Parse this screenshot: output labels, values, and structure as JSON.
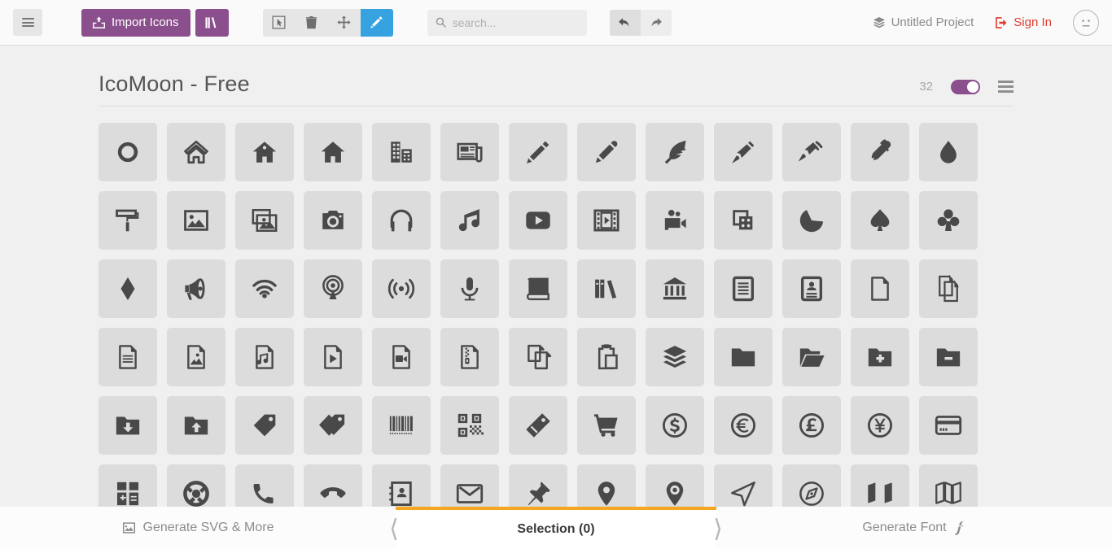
{
  "toolbar": {
    "menu_icon": "hamburger-icon",
    "import_label": "Import Icons",
    "import_icon": "upload-box-icon",
    "library_icon": "books-icon",
    "tools": [
      {
        "name": "select-tool",
        "icon": "cursor-select-icon",
        "active": false
      },
      {
        "name": "delete-tool",
        "icon": "trash-icon",
        "active": false
      },
      {
        "name": "move-tool",
        "icon": "move-arrows-icon",
        "active": false
      },
      {
        "name": "edit-tool",
        "icon": "pencil-icon",
        "active": true
      }
    ],
    "search": {
      "placeholder": "search...",
      "value": "",
      "icon": "search-icon"
    },
    "undo_icon": "undo-arrow-icon",
    "redo_icon": "redo-arrow-icon",
    "project_label": "Untitled Project",
    "project_icon": "stack-layers-icon",
    "signin_label": "Sign In",
    "signin_icon": "login-arrow-icon",
    "avatar_icon": "neutral-face-icon",
    "accent_purple": "#8a4f8c",
    "accent_blue": "#37a2e0",
    "accent_red": "#e23a2e"
  },
  "iconset": {
    "title": "IcoMoon - Free",
    "count": "32",
    "toggle_on": true,
    "toggle_color": "#8a4f8c",
    "menu_icon": "list-menu-icon",
    "icons": [
      "home3",
      "home",
      "home2",
      "home5",
      "office",
      "newspaper",
      "pencil",
      "pencil2",
      "quill",
      "pen",
      "blog",
      "eyedropper",
      "droplet",
      "paint-format",
      "image",
      "images",
      "camera",
      "headphones",
      "music",
      "play",
      "film",
      "video-camera",
      "dice",
      "pacman",
      "spades",
      "clubs",
      "diamonds",
      "bullhorn",
      "connection",
      "podcast",
      "feed",
      "mic",
      "book",
      "books",
      "library",
      "file-text",
      "profile",
      "file-empty",
      "files-empty",
      "file-text2",
      "file-picture",
      "file-music",
      "file-play",
      "file-video",
      "file-zip",
      "copy",
      "paste",
      "stack",
      "folder",
      "folder-open",
      "folder-plus",
      "folder-minus",
      "folder-download",
      "folder-upload",
      "price-tag",
      "price-tags",
      "barcode",
      "qrcode",
      "ticket",
      "cart",
      "coin-dollar",
      "coin-euro",
      "coin-pound",
      "coin-yen",
      "credit-card",
      "calculator",
      "lifebuoy",
      "phone",
      "phone-hang-up",
      "address-book",
      "envelop",
      "pushpin",
      "location",
      "location2",
      "compass",
      "compass2",
      "map",
      "map2"
    ]
  },
  "bottombar": {
    "left_label": "Generate SVG & More",
    "left_icon": "image-icon",
    "center_label": "Selection (0)",
    "right_label": "Generate Font",
    "right_icon": "font-f-icon",
    "prev_chevron": "chevron-left-icon",
    "next_chevron": "chevron-right-icon",
    "active_color": "#f5a623"
  }
}
